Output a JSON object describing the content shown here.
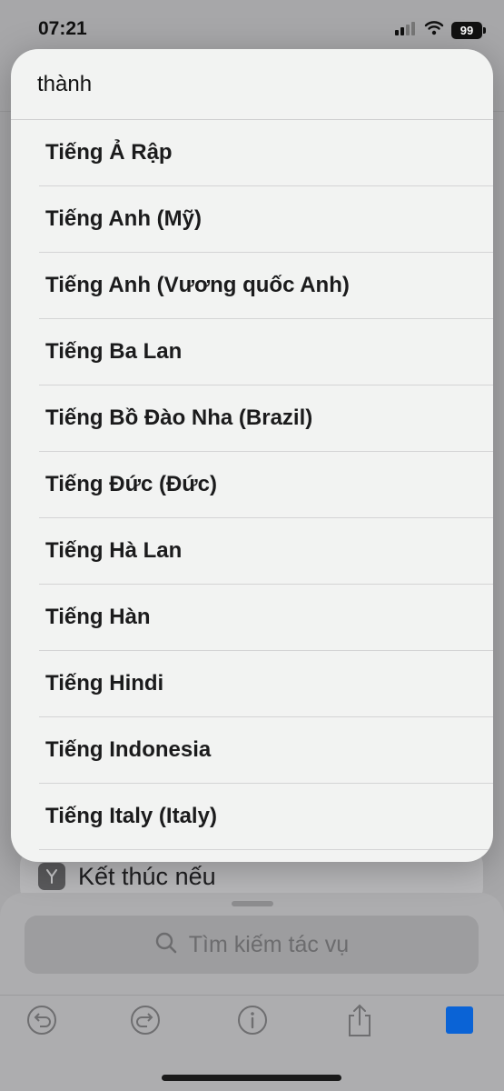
{
  "status_bar": {
    "time": "07:21",
    "battery": "99"
  },
  "popup": {
    "header": "thành",
    "items": [
      "Tiếng Ả Rập",
      "Tiếng Anh (Mỹ)",
      "Tiếng Anh (Vương quốc Anh)",
      "Tiếng Ba Lan",
      "Tiếng Bồ Đào Nha (Brazil)",
      "Tiếng Đức (Đức)",
      "Tiếng Hà Lan",
      "Tiếng Hàn",
      "Tiếng Hindi",
      "Tiếng Indonesia",
      "Tiếng Italy (Italy)"
    ]
  },
  "background": {
    "end_if_label": "Kết thúc nếu",
    "search_placeholder": "Tìm kiếm tác vụ"
  },
  "toolbar": {
    "icons": [
      "undo-icon",
      "redo-icon",
      "info-icon",
      "share-icon",
      "run-icon"
    ],
    "accent_color": "#0a63d6"
  }
}
